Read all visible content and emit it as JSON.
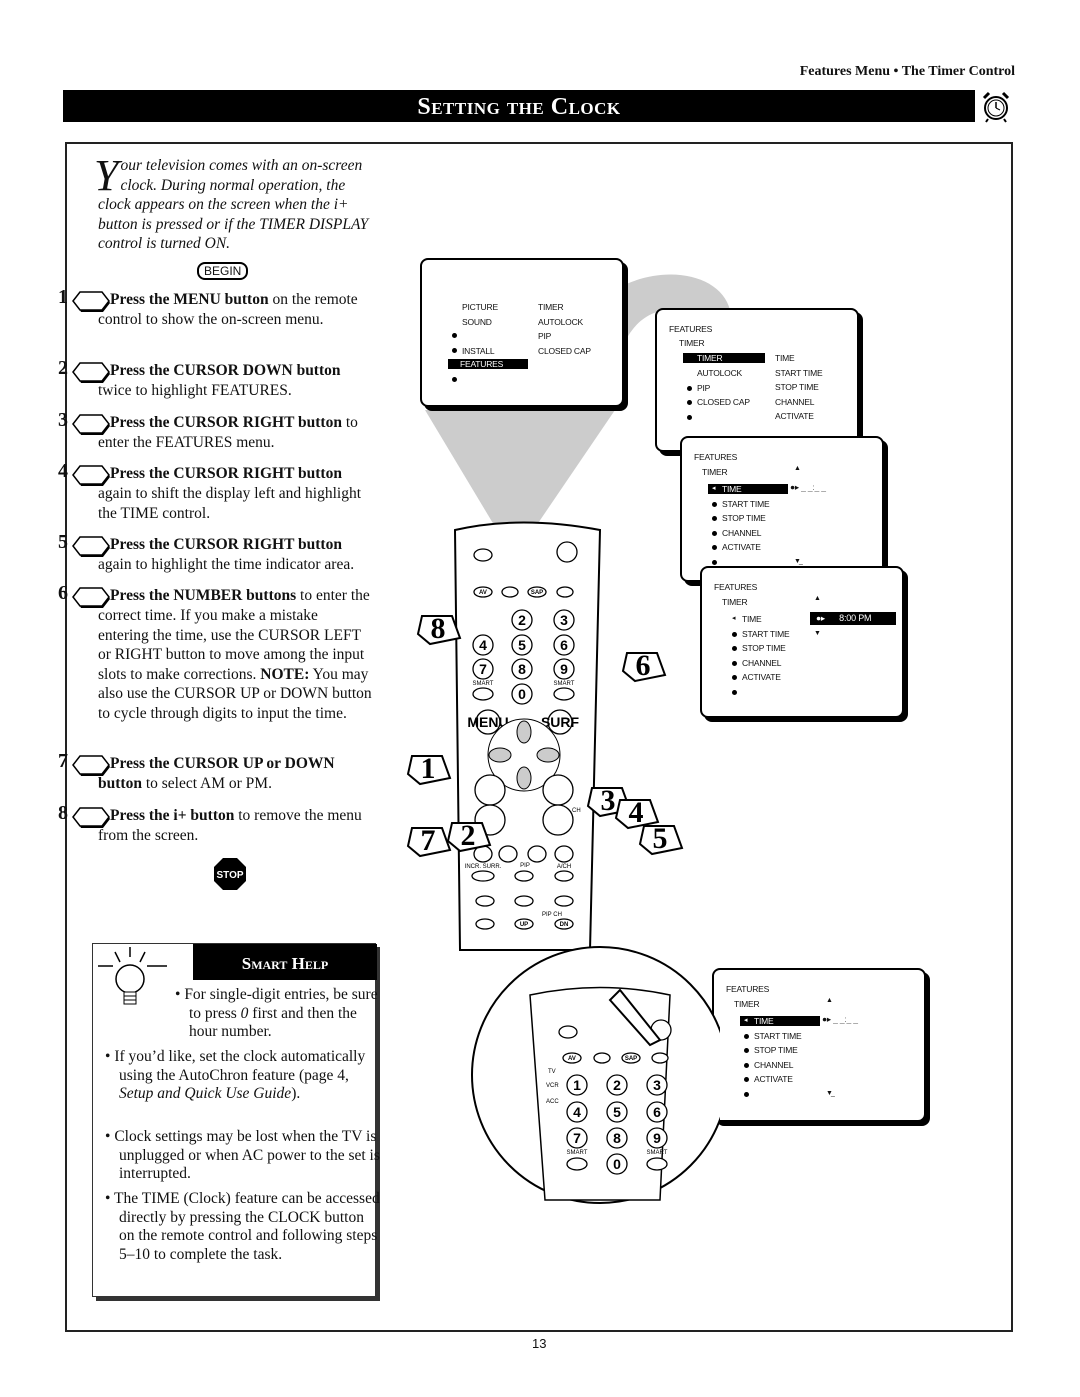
{
  "header": {
    "section": "Features Menu • The Timer Control",
    "title": "Setting the Clock",
    "title_icon": "alarm-clock-icon"
  },
  "intro": {
    "dropcap": "Y",
    "text": "our television comes with an on-screen clock. During normal operation, the clock appears on the screen when the i+ button is pressed or if the TIMER DISPLAY control is turned ON."
  },
  "begin_label": "BEGIN",
  "steps": [
    {
      "num": "1",
      "bold": "Press the MENU button",
      "rest": " on the remote control to show the on-screen menu."
    },
    {
      "num": "2",
      "bold": "Press the CURSOR DOWN button",
      "rest": " twice to highlight FEATURES."
    },
    {
      "num": "3",
      "bold": "Press the CURSOR RIGHT button",
      "rest": " to enter the FEATURES menu."
    },
    {
      "num": "4",
      "bold": "Press the CURSOR RIGHT button",
      "rest": " again to shift the display left and highlight the TIME control."
    },
    {
      "num": "5",
      "bold": "Press the CURSOR RIGHT button",
      "rest": " again to highlight the time indicator area."
    },
    {
      "num": "6",
      "bold": "Press the NUMBER buttons",
      "rest": " to enter the correct time. If you make a mistake entering the time, use the CURSOR LEFT or RIGHT button to move among the input slots to make corrections. ",
      "note": "NOTE:",
      "note_rest": " You may also use the CURSOR UP or DOWN button to cycle through digits to input the time."
    },
    {
      "num": "7",
      "bold": "Press the CURSOR UP or DOWN button",
      "rest": " to select AM or PM."
    },
    {
      "num": "8",
      "bold": "Press the i+ button",
      "rest": " to remove the menu from the screen."
    }
  ],
  "stop_label": "STOP",
  "smart_help": {
    "title": "Smart Help",
    "bullets": [
      {
        "pre": "For single-digit entries, be sure to press ",
        "em": "0",
        "post": " first and then the hour number."
      },
      {
        "pre": "If you’d like, set the clock automatically using the AutoChron feature (page 4, ",
        "em": "Setup and Quick Use Guide",
        "post": ")."
      },
      {
        "pre": "Clock settings may be lost when the TV is unplugged or when AC power to the set is interrupted.",
        "em": "",
        "post": ""
      },
      {
        "pre": "The TIME (Clock) feature can be accessed directly by pressing the CLOCK button on the remote control and following steps 5–10 to complete the task.",
        "em": "",
        "post": ""
      }
    ]
  },
  "menus": {
    "main": {
      "left": [
        "PICTURE",
        "SOUND",
        "FEATURES",
        "INSTALL"
      ],
      "right": [
        "TIMER",
        "AUTOLOCK",
        "PIP",
        "CLOSED CAP"
      ],
      "highlight": "FEATURES"
    },
    "features": {
      "title": "FEATURES",
      "sub": "TIMER",
      "left": [
        "TIMER",
        "AUTOLOCK",
        "PIP",
        "CLOSED CAP"
      ],
      "right": [
        "TIME",
        "START TIME",
        "STOP TIME",
        "CHANNEL",
        "ACTIVATE"
      ],
      "highlight": "TIMER"
    },
    "timer": {
      "title": "FEATURES",
      "sub": "TIMER",
      "items": [
        "TIME",
        "START TIME",
        "STOP TIME",
        "CHANNEL",
        "ACTIVATE"
      ],
      "highlight": "TIME",
      "value": "_ _:_ _"
    },
    "timer_set": {
      "title": "FEATURES",
      "sub": "TIMER",
      "items": [
        "TIME",
        "START TIME",
        "STOP TIME",
        "CHANNEL",
        "ACTIVATE"
      ],
      "value": "8:00 PM"
    },
    "timer_bottom": {
      "title": "FEATURES",
      "sub": "TIMER",
      "items": [
        "TIME",
        "START TIME",
        "STOP TIME",
        "CHANNEL",
        "ACTIVATE"
      ],
      "highlight": "TIME",
      "value": "_ _:_ _"
    }
  },
  "remote": {
    "labels": {
      "av": "AV",
      "sap": "SAP",
      "tv": "TV",
      "vcr": "VCR",
      "acc": "ACC",
      "smart": "SMART",
      "menu": "MENU",
      "surf": "SURF",
      "ch": "CH",
      "incr": "INCR. SURR.",
      "pip": "PIP",
      "ach": "A/CH",
      "pipch": "PIP CH",
      "up": "UP",
      "dn": "DN"
    },
    "digits": [
      "1",
      "2",
      "3",
      "4",
      "5",
      "6",
      "7",
      "8",
      "9",
      "0"
    ],
    "callouts": [
      "1",
      "2",
      "3",
      "4",
      "5",
      "6",
      "7",
      "8"
    ]
  },
  "page_number": "13"
}
